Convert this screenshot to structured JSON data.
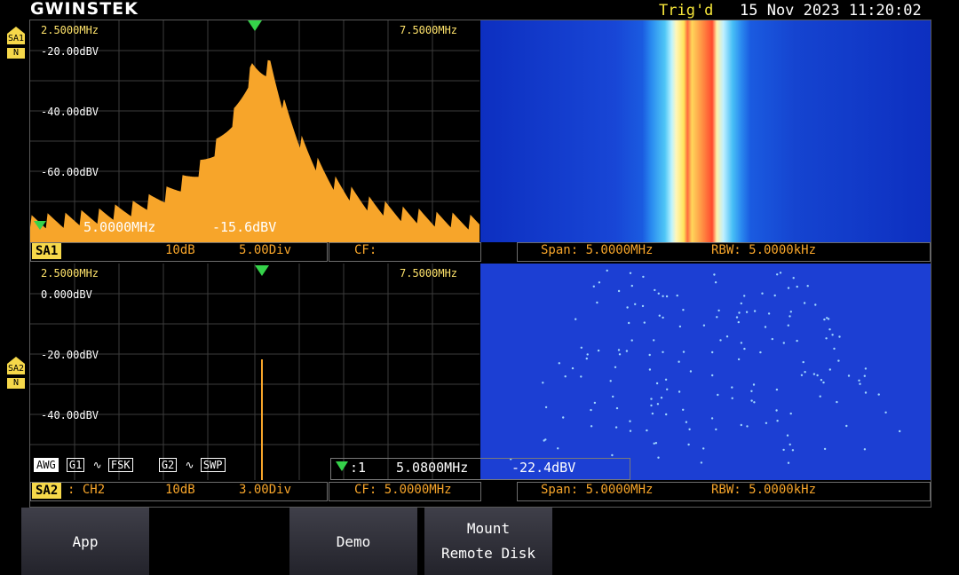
{
  "header": {
    "logo": "GWINSTEK",
    "trig_status": "Trig'd",
    "datetime": "15 Nov 2023 11:20:02"
  },
  "sa1": {
    "side_label": "SA1",
    "side_mode": "N",
    "start_freq": "2.5000MHz",
    "stop_freq": "7.5000MHz",
    "y_ticks": [
      "-20.00dBV",
      "-40.00dBV",
      "-60.00dBV"
    ],
    "marker_freq": "5.0000MHz",
    "marker_level": "-15.6dBV",
    "status_tag": "SA1",
    "status_fields": [
      "10dB",
      "5.00Div",
      "CF:"
    ],
    "span": "Span: 5.0000MHz",
    "rbw": "RBW: 5.0000kHz"
  },
  "sa2": {
    "side_label": "SA2",
    "side_mode": "N",
    "start_freq": "2.5000MHz",
    "stop_freq": "7.5000MHz",
    "y_ticks": [
      "0.000dBV",
      "-20.00dBV",
      "-40.00dBV"
    ],
    "awg_label": "AWG",
    "g1_label": "G1",
    "fsk_label": "FSK",
    "g2_label": "G2",
    "swp_label": "SWP",
    "marker_index": ":1",
    "marker_freq": "5.0800MHz",
    "marker_level": "-22.4dBV",
    "status_tag": "SA2",
    "channel": ": CH2",
    "scale": "10dB",
    "div": "3.00Div",
    "cf": "CF: 5.0000MHz",
    "span": "Span: 5.0000MHz",
    "rbw": "RBW: 5.0000kHz"
  },
  "softkeys": {
    "app": "App",
    "demo": "Demo",
    "mount_line1": "Mount",
    "mount_line2": "Remote Disk"
  },
  "colors": {
    "trace": "#f7a52a",
    "waterfall_bg": "#1b3fd2",
    "marker": "#35d24a"
  }
}
